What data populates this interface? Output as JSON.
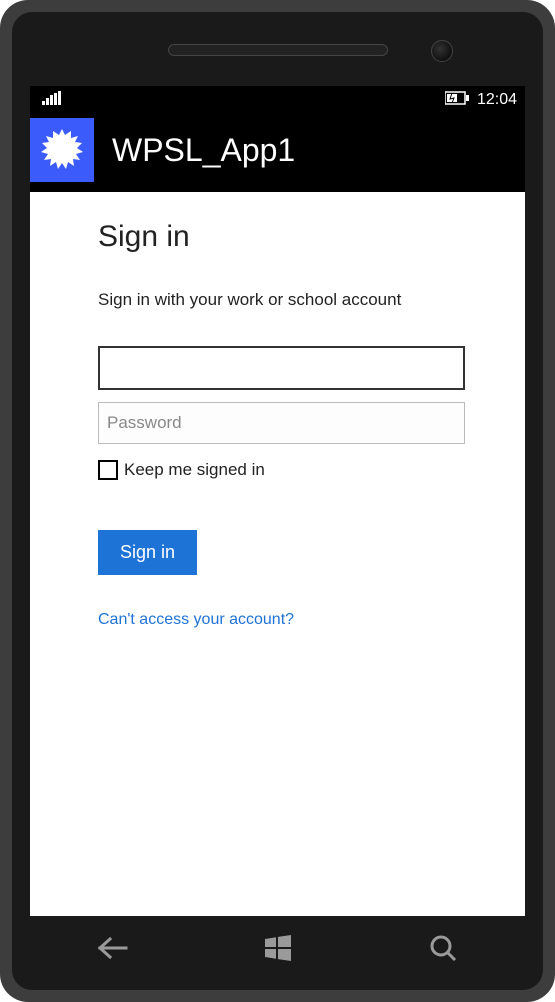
{
  "status": {
    "time": "12:04"
  },
  "header": {
    "app_title": "WPSL_App1"
  },
  "signin": {
    "title": "Sign in",
    "subtitle": "Sign in with your work or school account",
    "username_value": "",
    "password_placeholder": "Password",
    "password_value": "",
    "keep_signed_label": "Keep me signed in",
    "button_label": "Sign in",
    "cant_access_label": "Can't access your account?"
  }
}
